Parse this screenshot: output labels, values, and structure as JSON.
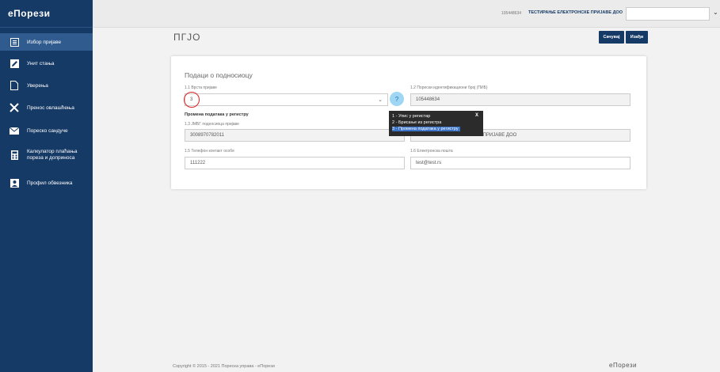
{
  "app": {
    "logo": "еПорези"
  },
  "sidebar": {
    "items": [
      {
        "label": "Избор пријаве",
        "icon": "list-box-icon",
        "active": true
      },
      {
        "label": "Унит стања",
        "icon": "pencil-icon"
      },
      {
        "label": "Уверења",
        "icon": "document-icon"
      },
      {
        "label": "Пренос овлашћења",
        "icon": "transfer-icon"
      },
      {
        "label": "Пореско сандуче",
        "icon": "envelope-icon"
      },
      {
        "label": "Калкулатор плаћања пореза и доприноса",
        "icon": "calculator-icon"
      },
      {
        "label": "Профил обвезника",
        "icon": "profile-icon"
      }
    ]
  },
  "topbar": {
    "pib": "105448634",
    "company": "ТЕСТИРАЊЕ ЕЛЕКТРОНСКЕ ПРИЈАВЕ ДОО",
    "select_value": ""
  },
  "page": {
    "title": "ПГЈО",
    "save_label": "Сачувај",
    "exit_label": "Изађи"
  },
  "form": {
    "section_title": "Подаци о подносиоцу",
    "f11_label": "1.1 Врста пријаве",
    "f11_value": "3",
    "f12_label": "1.2 Порески идентификациони број (ПИБ)",
    "f12_value": "105448634",
    "change_heading": "Промена података у регистру",
    "f13_label": "1.3 ЈМБГ подносиоца пријаве",
    "f13_value": "3008970782011",
    "f14_value": "ТЕСТИРАЊЕ ЕЛЕКТРОНСКЕ ПРИЈАВЕ ДОО",
    "f15_label": "1.5 Телефон контакт особе",
    "f15_value": "111222",
    "f16_label": "1.6 Електронска пошта",
    "f16_value": "test@test.rs",
    "help_label": "?"
  },
  "tooltip": {
    "close": "X",
    "options": [
      "1 - Упис у регистар",
      "2 - Брисање из регистра",
      "3 - Промена података у регистру"
    ]
  },
  "footer": {
    "copyright": "Copyright © 2015 - 2021 Пореска управа - еПорези",
    "brand": "еПорези"
  }
}
